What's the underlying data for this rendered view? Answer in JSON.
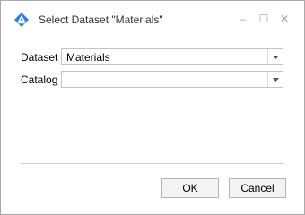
{
  "window": {
    "title": "Select Dataset \"Materials\"",
    "controls": {
      "minimize": "–",
      "maximize": "☐",
      "close": "✕"
    }
  },
  "form": {
    "dataset": {
      "label": "Dataset",
      "value": "Materials"
    },
    "catalog": {
      "label": "Catalog",
      "value": ""
    }
  },
  "buttons": {
    "ok": "OK",
    "cancel": "Cancel"
  },
  "colors": {
    "app_icon": "#2f7de1",
    "border": "#a9a9a9",
    "button_bg": "#f3f3f3"
  },
  "icons": {
    "app": "app-logo-icon",
    "dropdown": "chevron-down-icon"
  }
}
